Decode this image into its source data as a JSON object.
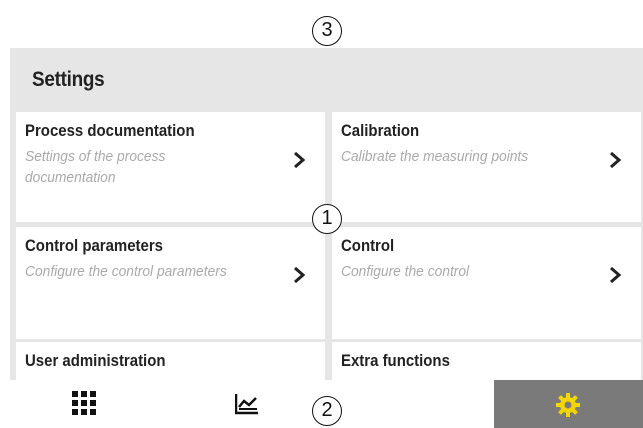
{
  "callouts": {
    "top": "3",
    "middle": "1",
    "bottom": "2"
  },
  "header": {
    "title": "Settings"
  },
  "tiles": [
    {
      "title": "Process documentation",
      "description": "Settings of the process documentation",
      "icon": "chevron-right-icon"
    },
    {
      "title": "Calibration",
      "description": "Calibrate the measuring points",
      "icon": "chevron-right-icon"
    },
    {
      "title": "Control parameters",
      "description": "Configure the control parameters",
      "icon": "chevron-right-icon"
    },
    {
      "title": "Control",
      "description": "Configure the control",
      "icon": "chevron-right-icon"
    },
    {
      "title": "User administration",
      "description": "",
      "icon": "chevron-right-icon"
    },
    {
      "title": "Extra functions",
      "description": "",
      "icon": "chevron-right-icon"
    }
  ],
  "nav": {
    "items": [
      {
        "icon": "grid-menu-icon",
        "active": false
      },
      {
        "icon": "chart-icon",
        "active": false
      },
      {
        "icon": "gear-icon",
        "active": true
      }
    ]
  },
  "colors": {
    "active_nav": "#7a7a7a",
    "gear": "#f2d600",
    "background": "#e6e6e6"
  }
}
